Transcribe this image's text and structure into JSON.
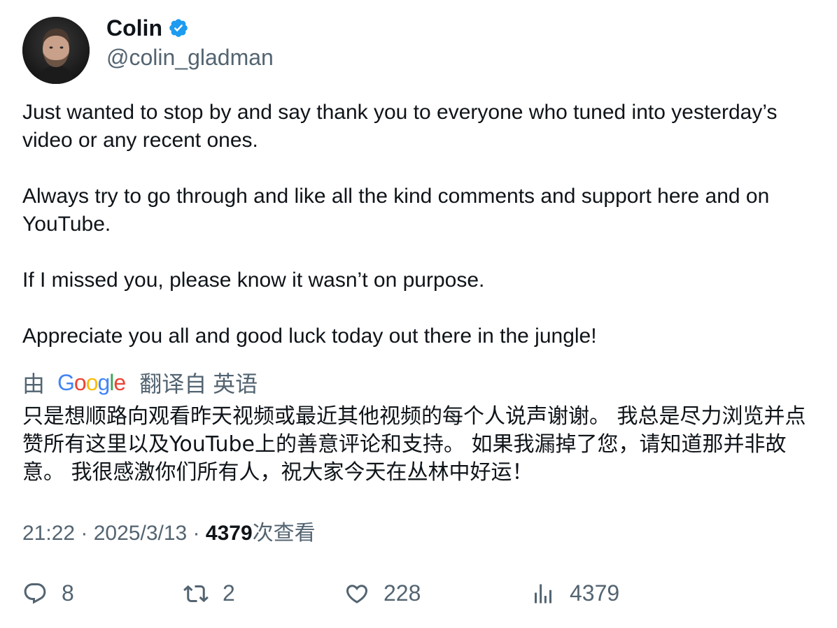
{
  "author": {
    "name": "Colin",
    "handle": "@colin_gladman",
    "verified_icon": "verified-badge-icon",
    "verified_color": "#1d9bf0"
  },
  "tweet": {
    "paragraphs": [
      "Just wanted to stop by and say thank you to everyone who tuned into yesterday’s video or any recent ones.",
      "Always try to go through and like all the kind comments and support here and on YouTube.",
      "If I missed you, please know it wasn’t on purpose.",
      "Appreciate you all and good luck today out there in the jungle!"
    ]
  },
  "translation": {
    "prefix": "由",
    "provider": "Google",
    "provider_letters": [
      "G",
      "o",
      "o",
      "g",
      "l",
      "e"
    ],
    "provider_colors": [
      "#4285F4",
      "#EA4335",
      "#FBBC05",
      "#4285F4",
      "#34A853",
      "#EA4335"
    ],
    "suffix": "翻译自 英语",
    "text": "只是想顺路向观看昨天视频或最近其他视频的每个人说声谢谢。 我总是尽力浏览并点赞所有这里以及YouTube上的善意评论和支持。 如果我漏掉了您，请知道那并非故意。 我很感激你们所有人，祝大家今天在丛林中好运！"
  },
  "meta": {
    "time": "21:22",
    "separator": " · ",
    "date": "2025/3/13",
    "views": "4379",
    "views_label": "次查看"
  },
  "actions": {
    "replies": "8",
    "reposts": "2",
    "likes": "228",
    "views": "4379"
  },
  "colors": {
    "text": "#0f1419",
    "secondary": "#536471"
  }
}
